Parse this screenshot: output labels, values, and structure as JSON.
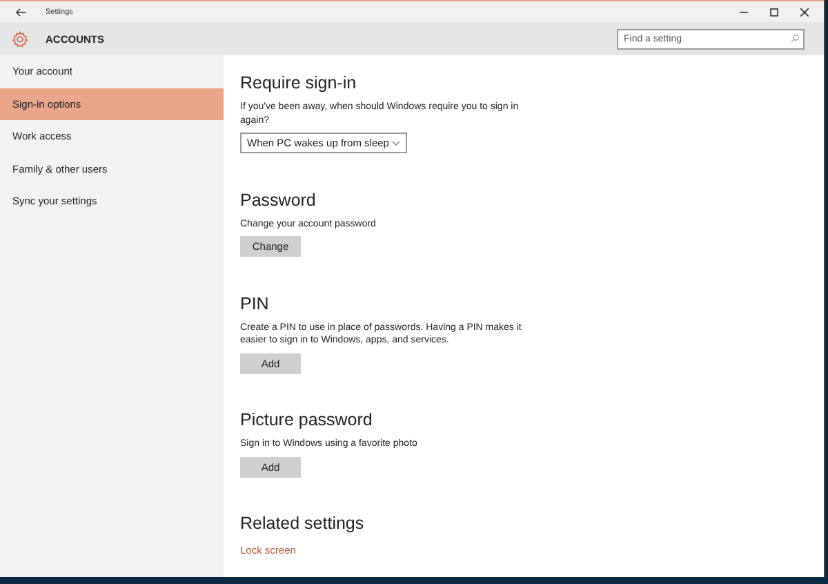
{
  "window": {
    "title": "Settings"
  },
  "header": {
    "title": "ACCOUNTS",
    "search": {
      "placeholder": "Find a setting"
    }
  },
  "sidebar": {
    "items": [
      {
        "label": "Your account",
        "selected": false
      },
      {
        "label": "Sign-in options",
        "selected": true
      },
      {
        "label": "Work access",
        "selected": false
      },
      {
        "label": "Family & other users",
        "selected": false
      },
      {
        "label": "Sync your settings",
        "selected": false
      }
    ]
  },
  "sections": [
    {
      "title": "Require sign-in",
      "description": "If you've been away, when should Windows require you to sign in again?",
      "control": {
        "kind": "dropdown",
        "label": "When PC wakes up from sleep"
      }
    },
    {
      "title": "Password",
      "description": "Change your account password",
      "control": {
        "kind": "button",
        "label": "Change"
      }
    },
    {
      "title": "PIN",
      "description": "Create a PIN to use in place of passwords. Having a PIN makes it easier to sign in to Windows, apps, and services.",
      "control": {
        "kind": "button",
        "label": "Add"
      }
    },
    {
      "title": "Picture password",
      "description": "Sign in to Windows using a favorite photo",
      "control": {
        "kind": "button",
        "label": "Add"
      }
    },
    {
      "title": "Related settings",
      "control": {
        "kind": "link",
        "label": "Lock screen"
      }
    }
  ]
}
